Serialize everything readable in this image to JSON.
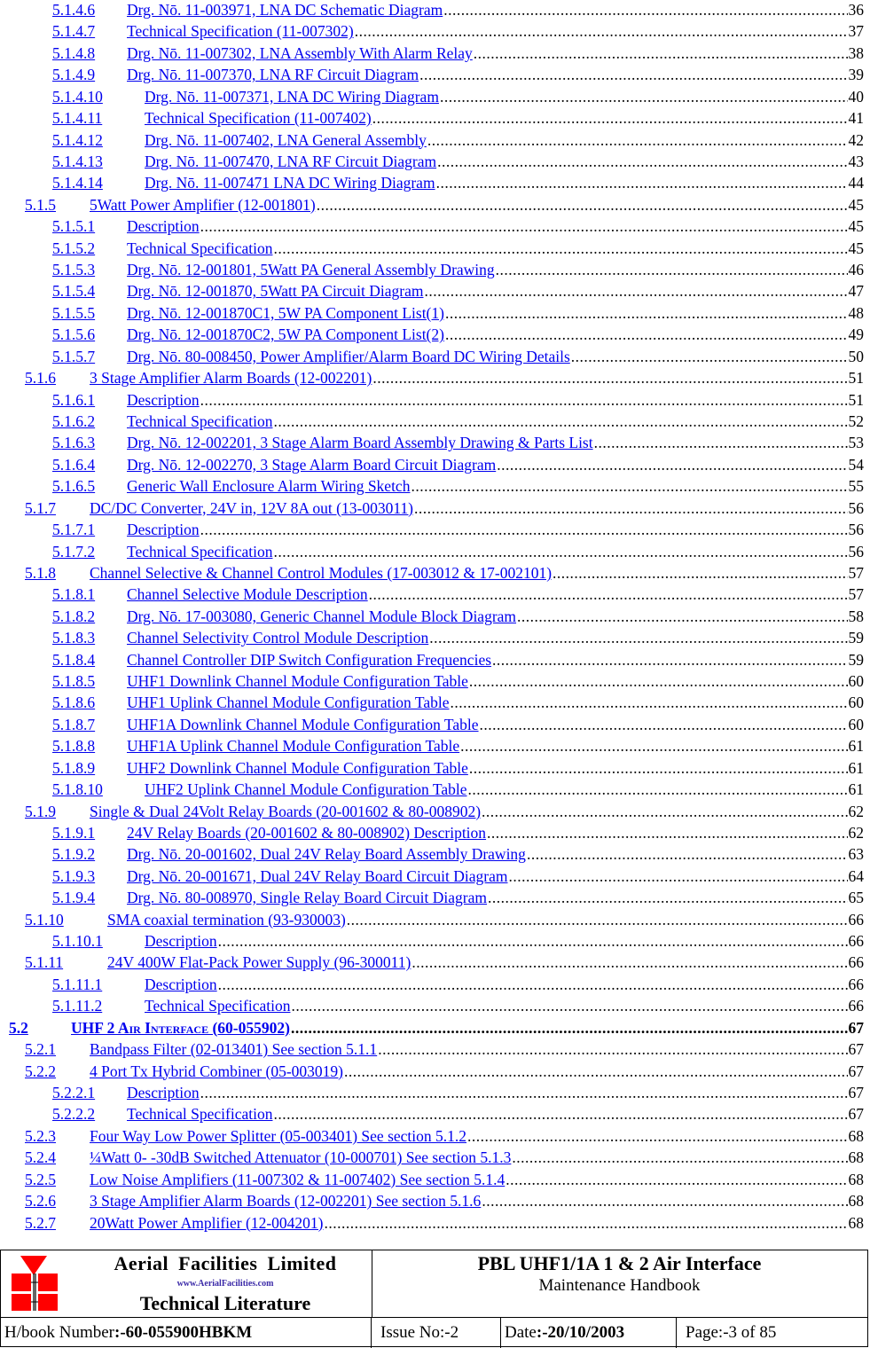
{
  "toc": [
    {
      "num": "5.1.4.6",
      "title": "Drg. Nō. 11-003971, LNA DC Schematic Diagram",
      "page": "36",
      "level": 4
    },
    {
      "num": "5.1.4.7",
      "title": "Technical Specification (11-007302)",
      "page": "37",
      "level": 4
    },
    {
      "num": "5.1.4.8",
      "title": "Drg. Nō. 11-007302, LNA Assembly With Alarm Relay",
      "page": "38",
      "level": 4
    },
    {
      "num": "5.1.4.9",
      "title": "Drg. Nō. 11-007370, LNA RF Circuit Diagram",
      "page": "39",
      "level": 4
    },
    {
      "num": "5.1.4.10",
      "title": "Drg. Nō. 11-007371, LNA DC Wiring Diagram",
      "page": "40",
      "level": 4,
      "wide": true
    },
    {
      "num": "5.1.4.11",
      "title": "Technical Specification (11-007402)",
      "page": "41",
      "level": 4,
      "wide": true
    },
    {
      "num": "5.1.4.12",
      "title": "Drg. Nō. 11-007402, LNA General Assembly",
      "page": "42",
      "level": 4,
      "wide": true
    },
    {
      "num": "5.1.4.13",
      "title": "Drg. Nō. 11-007470, LNA RF Circuit Diagram",
      "page": "43",
      "level": 4,
      "wide": true
    },
    {
      "num": "5.1.4.14",
      "title": "Drg. Nō. 11-007471 LNA DC Wiring Diagram",
      "page": "44",
      "level": 4,
      "wide": true
    },
    {
      "num": "5.1.5",
      "title": "5Watt Power Amplifier (12-001801)",
      "page": "45",
      "level": 3
    },
    {
      "num": "5.1.5.1",
      "title": "Description",
      "page": "45",
      "level": 4
    },
    {
      "num": "5.1.5.2",
      "title": "Technical Specification",
      "page": "45",
      "level": 4
    },
    {
      "num": "5.1.5.3",
      "title": "Drg. Nō. 12-001801, 5Watt PA General Assembly Drawing",
      "page": "46",
      "level": 4
    },
    {
      "num": "5.1.5.4",
      "title": "Drg. Nō. 12-001870, 5Watt PA Circuit Diagram",
      "page": "47",
      "level": 4
    },
    {
      "num": "5.1.5.5",
      "title": "Drg. Nō. 12-001870C1, 5W PA Component List(1)",
      "page": "48",
      "level": 4
    },
    {
      "num": "5.1.5.6",
      "title": "Drg. Nō. 12-001870C2, 5W PA Component List(2)",
      "page": "49",
      "level": 4
    },
    {
      "num": "5.1.5.7",
      "title": "Drg. Nō. 80-008450, Power Amplifier/Alarm Board DC Wiring Details",
      "page": "50",
      "level": 4
    },
    {
      "num": "5.1.6",
      "title": "3 Stage Amplifier Alarm Boards (12-002201)",
      "page": "51",
      "level": 3
    },
    {
      "num": "5.1.6.1",
      "title": "Description",
      "page": "51",
      "level": 4
    },
    {
      "num": "5.1.6.2",
      "title": "Technical Specification",
      "page": "52",
      "level": 4
    },
    {
      "num": "5.1.6.3",
      "title": "Drg. Nō. 12-002201, 3 Stage Alarm Board Assembly Drawing & Parts List",
      "page": "53",
      "level": 4
    },
    {
      "num": "5.1.6.4",
      "title": "Drg. Nō. 12-002270, 3 Stage Alarm Board Circuit Diagram",
      "page": "54",
      "level": 4
    },
    {
      "num": "5.1.6.5",
      "title": "Generic Wall Enclosure Alarm Wiring Sketch",
      "page": "55",
      "level": 4
    },
    {
      "num": "5.1.7",
      "title": "DC/DC Converter, 24V in, 12V 8A out (13-003011)",
      "page": "56",
      "level": 3
    },
    {
      "num": "5.1.7.1",
      "title": "Description",
      "page": "56",
      "level": 4
    },
    {
      "num": "5.1.7.2",
      "title": "Technical Specification",
      "page": "56",
      "level": 4
    },
    {
      "num": "5.1.8",
      "title": "Channel Selective & Channel Control Modules (17-003012 & 17-002101)",
      "page": "57",
      "level": 3
    },
    {
      "num": "5.1.8.1",
      "title": "Channel Selective Module Description",
      "page": "57",
      "level": 4
    },
    {
      "num": "5.1.8.2",
      "title": "Drg. Nō. 17-003080, Generic Channel Module Block Diagram",
      "page": "58",
      "level": 4
    },
    {
      "num": "5.1.8.3",
      "title": "Channel Selectivity Control Module Description",
      "page": "59",
      "level": 4
    },
    {
      "num": "5.1.8.4",
      "title": "Channel Controller DIP Switch Configuration Frequencies",
      "page": "59",
      "level": 4
    },
    {
      "num": "5.1.8.5",
      "title": "UHF1 Downlink Channel Module Configuration Table",
      "page": "60",
      "level": 4
    },
    {
      "num": "5.1.8.6",
      "title": "UHF1 Uplink Channel Module Configuration Table",
      "page": "60",
      "level": 4
    },
    {
      "num": "5.1.8.7",
      "title": "UHF1A Downlink Channel Module Configuration Table",
      "page": "60",
      "level": 4
    },
    {
      "num": "5.1.8.8",
      "title": "UHF1A Uplink Channel Module Configuration Table",
      "page": "61",
      "level": 4
    },
    {
      "num": "5.1.8.9",
      "title": "UHF2 Downlink Channel Module Configuration Table",
      "page": "61",
      "level": 4
    },
    {
      "num": "5.1.8.10",
      "title": "UHF2 Uplink Channel Module Configuration Table",
      "page": "61",
      "level": 4,
      "wide": true
    },
    {
      "num": "5.1.9",
      "title": "Single & Dual 24Volt Relay Boards (20-001602 & 80-008902)",
      "page": "62",
      "level": 3
    },
    {
      "num": "5.1.9.1",
      "title": "24V Relay Boards (20-001602 & 80-008902) Description",
      "page": "62",
      "level": 4
    },
    {
      "num": "5.1.9.2",
      "title": "Drg. Nō. 20-001602, Dual 24V Relay Board Assembly Drawing",
      "page": "63",
      "level": 4
    },
    {
      "num": "5.1.9.3",
      "title": "Drg. Nō. 20-001671, Dual 24V Relay Board Circuit Diagram",
      "page": "64",
      "level": 4
    },
    {
      "num": "5.1.9.4",
      "title": "Drg. Nō. 80-008970, Single Relay Board Circuit Diagram",
      "page": "65",
      "level": 4
    },
    {
      "num": "5.1.10",
      "title": "SMA coaxial termination (93-930003)",
      "page": "66",
      "level": 3,
      "wide": true
    },
    {
      "num": "5.1.10.1",
      "title": "Description",
      "page": "66",
      "level": 4,
      "wide": true
    },
    {
      "num": "5.1.11",
      "title": "24V 400W Flat-Pack Power Supply (96-300011)",
      "page": "66",
      "level": 3,
      "wide": true
    },
    {
      "num": "5.1.11.1",
      "title": "Description",
      "page": "66",
      "level": 4,
      "wide": true
    },
    {
      "num": "5.1.11.2",
      "title": "Technical Specification",
      "page": "66",
      "level": 4,
      "wide": true
    },
    {
      "num": "5.2",
      "title": "UHF 2 Air Interface (60-055902)",
      "page": "67",
      "level": 2,
      "bold": true
    },
    {
      "num": "5.2.1",
      "title": "Bandpass Filter (02-013401) See section 5.1.1",
      "page": "67",
      "level": 3
    },
    {
      "num": "5.2.2",
      "title": "4 Port Tx Hybrid Combiner (05-003019)",
      "page": "67",
      "level": 3
    },
    {
      "num": "5.2.2.1",
      "title": "Description",
      "page": "67",
      "level": 4
    },
    {
      "num": "5.2.2.2",
      "title": "Technical Specification",
      "page": "67",
      "level": 4
    },
    {
      "num": "5.2.3",
      "title": "Four Way Low Power Splitter (05-003401) See section 5.1.2",
      "page": "68",
      "level": 3
    },
    {
      "num": "5.2.4",
      "title": "¼Watt 0- -30dB Switched Attenuator (10-000701) See section 5.1.3",
      "page": "68",
      "level": 3
    },
    {
      "num": "5.2.5",
      "title": "Low Noise Amplifiers (11-007302 & 11-007402) See section 5.1.4",
      "page": "68",
      "level": 3
    },
    {
      "num": "5.2.6",
      "title": "3 Stage Amplifier Alarm Boards (12-002201) See section 5.1.6",
      "page": "68",
      "level": 3
    },
    {
      "num": "5.2.7",
      "title": "20Watt Power Amplifier (12-004201)",
      "page": "68",
      "level": 3
    }
  ],
  "footer": {
    "company": "Aerial Facilities Limited",
    "website": "www.AerialFacilities.com",
    "tagline": "Technical Literature",
    "doc_title": "PBL UHF1/1A 1 & 2 Air Interface",
    "doc_subtitle": "Maintenance Handbook",
    "hbook_label": "H/book Number",
    "hbook_value": ":-60-055900HBKM",
    "issue_label": "Issue No:-2",
    "date_label": "Date",
    "date_value": ":-20/10/2003",
    "page_label": "Page:-3 of 85",
    "logo_color": "#ff0000"
  }
}
